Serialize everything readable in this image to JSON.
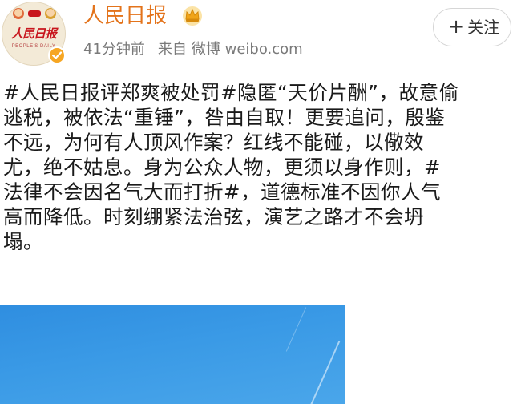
{
  "header": {
    "user_name": "人民日报",
    "time": "41分钟前",
    "source_label": "来自",
    "source_app": "微博 weibo.com",
    "follow_label": "关注",
    "follow_icon": "plus-icon",
    "badge_icon": "crown-icon",
    "verified_icon": "verified-check-icon"
  },
  "avatar": {
    "logo_text": "人民日报",
    "sub_text": "PEOPLE'S DAILY"
  },
  "post": {
    "lines": [
      "#人民日报评郑爽被处罚#隐匿“天价片酬”，故意偷",
      "逃税，被依法“重锤”，咎由自取！更要追问，殷鉴",
      "不远，为何有人顶风作案？红线不能碰，以儆效",
      "尤，绝不姑息。身为公众人物，更须以身作则，#",
      "法律不会因名气大而打折#，道德标准不因你人气",
      "高而降低。时刻绷紧法治弦，演艺之路才不会坍",
      "塌。"
    ]
  },
  "colors": {
    "name": "#e3731b",
    "meta": "#7a7a7a",
    "text": "#1a1a1a",
    "image_blue": "#3a9ae6"
  }
}
